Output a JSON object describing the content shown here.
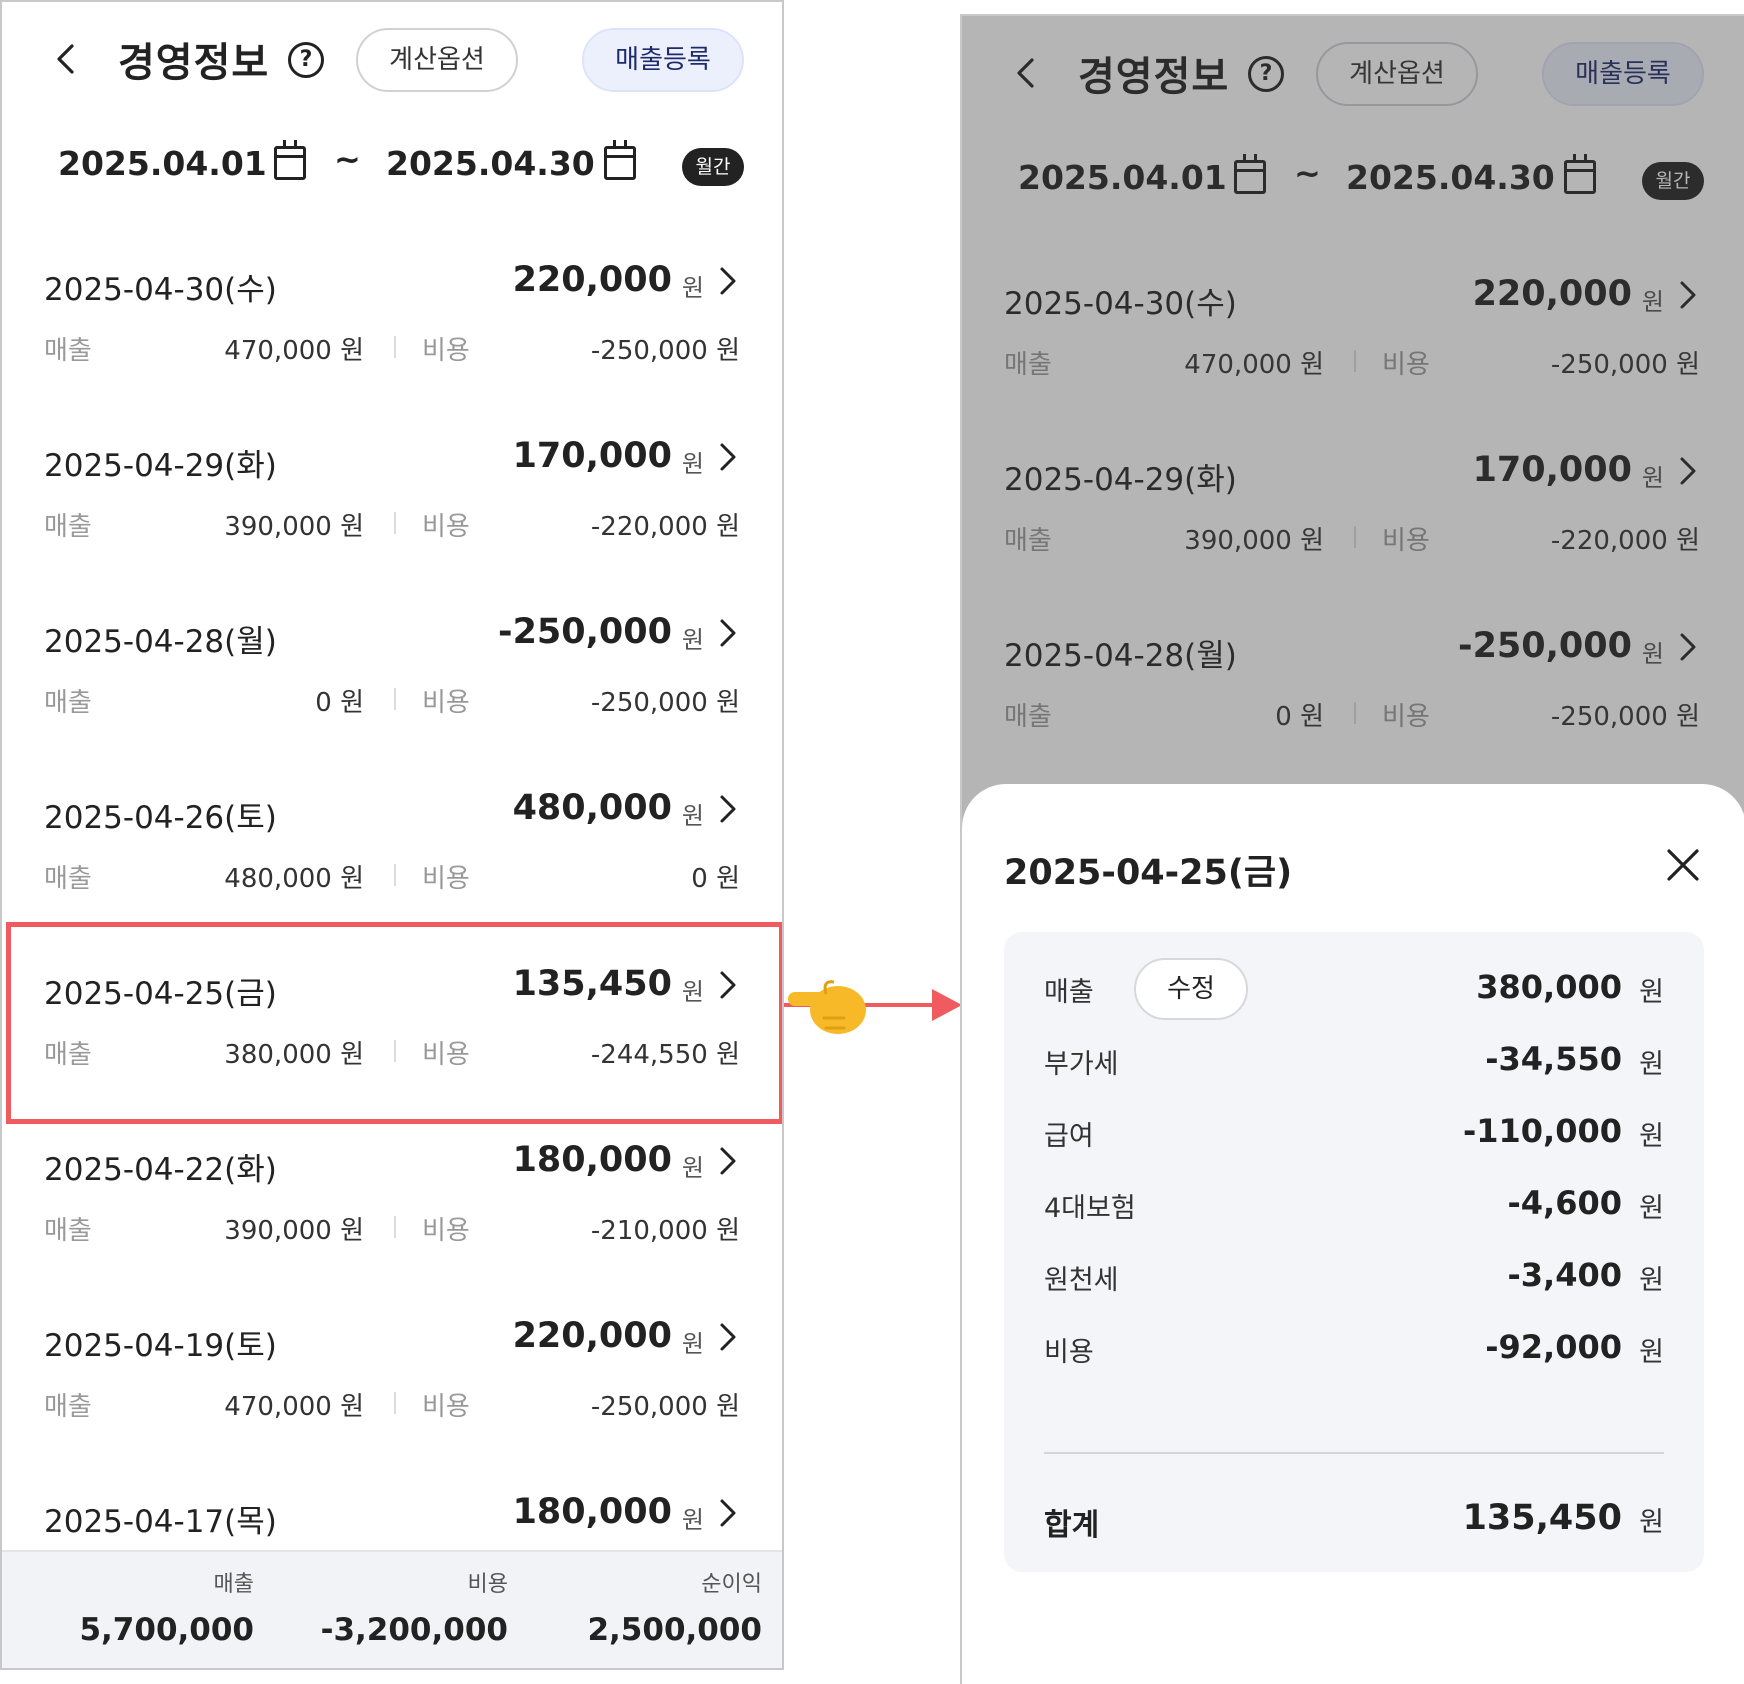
{
  "screen": {
    "back_icon": "chevron-left-icon",
    "title": "경영정보",
    "help_icon": "question-circle-icon",
    "calc_option_label": "계산옵션",
    "sales_register_label": "매출등록",
    "date_from": "2025.04.01",
    "date_to": "2025.04.30",
    "date_separator": "~",
    "calendar_icon": "calendar-icon",
    "period_badge": "월간"
  },
  "labels": {
    "sales": "매출",
    "cost": "비용",
    "currency": "원"
  },
  "rows": [
    {
      "date": "2025-04-30(수)",
      "total": "220,000",
      "sales": "470,000 원",
      "cost": "-250,000 원"
    },
    {
      "date": "2025-04-29(화)",
      "total": "170,000",
      "sales": "390,000 원",
      "cost": "-220,000 원"
    },
    {
      "date": "2025-04-28(월)",
      "total": "-250,000",
      "sales": "0 원",
      "cost": "-250,000 원"
    },
    {
      "date": "2025-04-26(토)",
      "total": "480,000",
      "sales": "480,000 원",
      "cost": "0 원"
    },
    {
      "date": "2025-04-25(금)",
      "total": "135,450",
      "sales": "380,000 원",
      "cost": "-244,550 원"
    },
    {
      "date": "2025-04-22(화)",
      "total": "180,000",
      "sales": "390,000 원",
      "cost": "-210,000 원"
    },
    {
      "date": "2025-04-19(토)",
      "total": "220,000",
      "sales": "470,000 원",
      "cost": "-250,000 원"
    },
    {
      "date": "2025-04-17(목)",
      "total": "180,000"
    }
  ],
  "footer": {
    "sales_label": "매출",
    "sales_value": "5,700,000",
    "cost_label": "비용",
    "cost_value": "-3,200,000",
    "profit_label": "순이익",
    "profit_value": "2,500,000"
  },
  "detail_sheet": {
    "title": "2025-04-25(금)",
    "close_icon": "close-icon",
    "edit_label": "수정",
    "items": [
      {
        "label": "매출",
        "value": "380,000"
      },
      {
        "label": "부가세",
        "value": "-34,550"
      },
      {
        "label": "급여",
        "value": "-110,000"
      },
      {
        "label": "4대보험",
        "value": "-4,600"
      },
      {
        "label": "원천세",
        "value": "-3,400"
      },
      {
        "label": "비용",
        "value": "-92,000"
      }
    ],
    "total_label": "합계",
    "total_value": "135,450"
  },
  "annotation": {
    "highlight_color": "#ef5b5e",
    "pointer_icon": "pointing-hand-icon",
    "arrow_icon": "arrow-right-icon"
  }
}
